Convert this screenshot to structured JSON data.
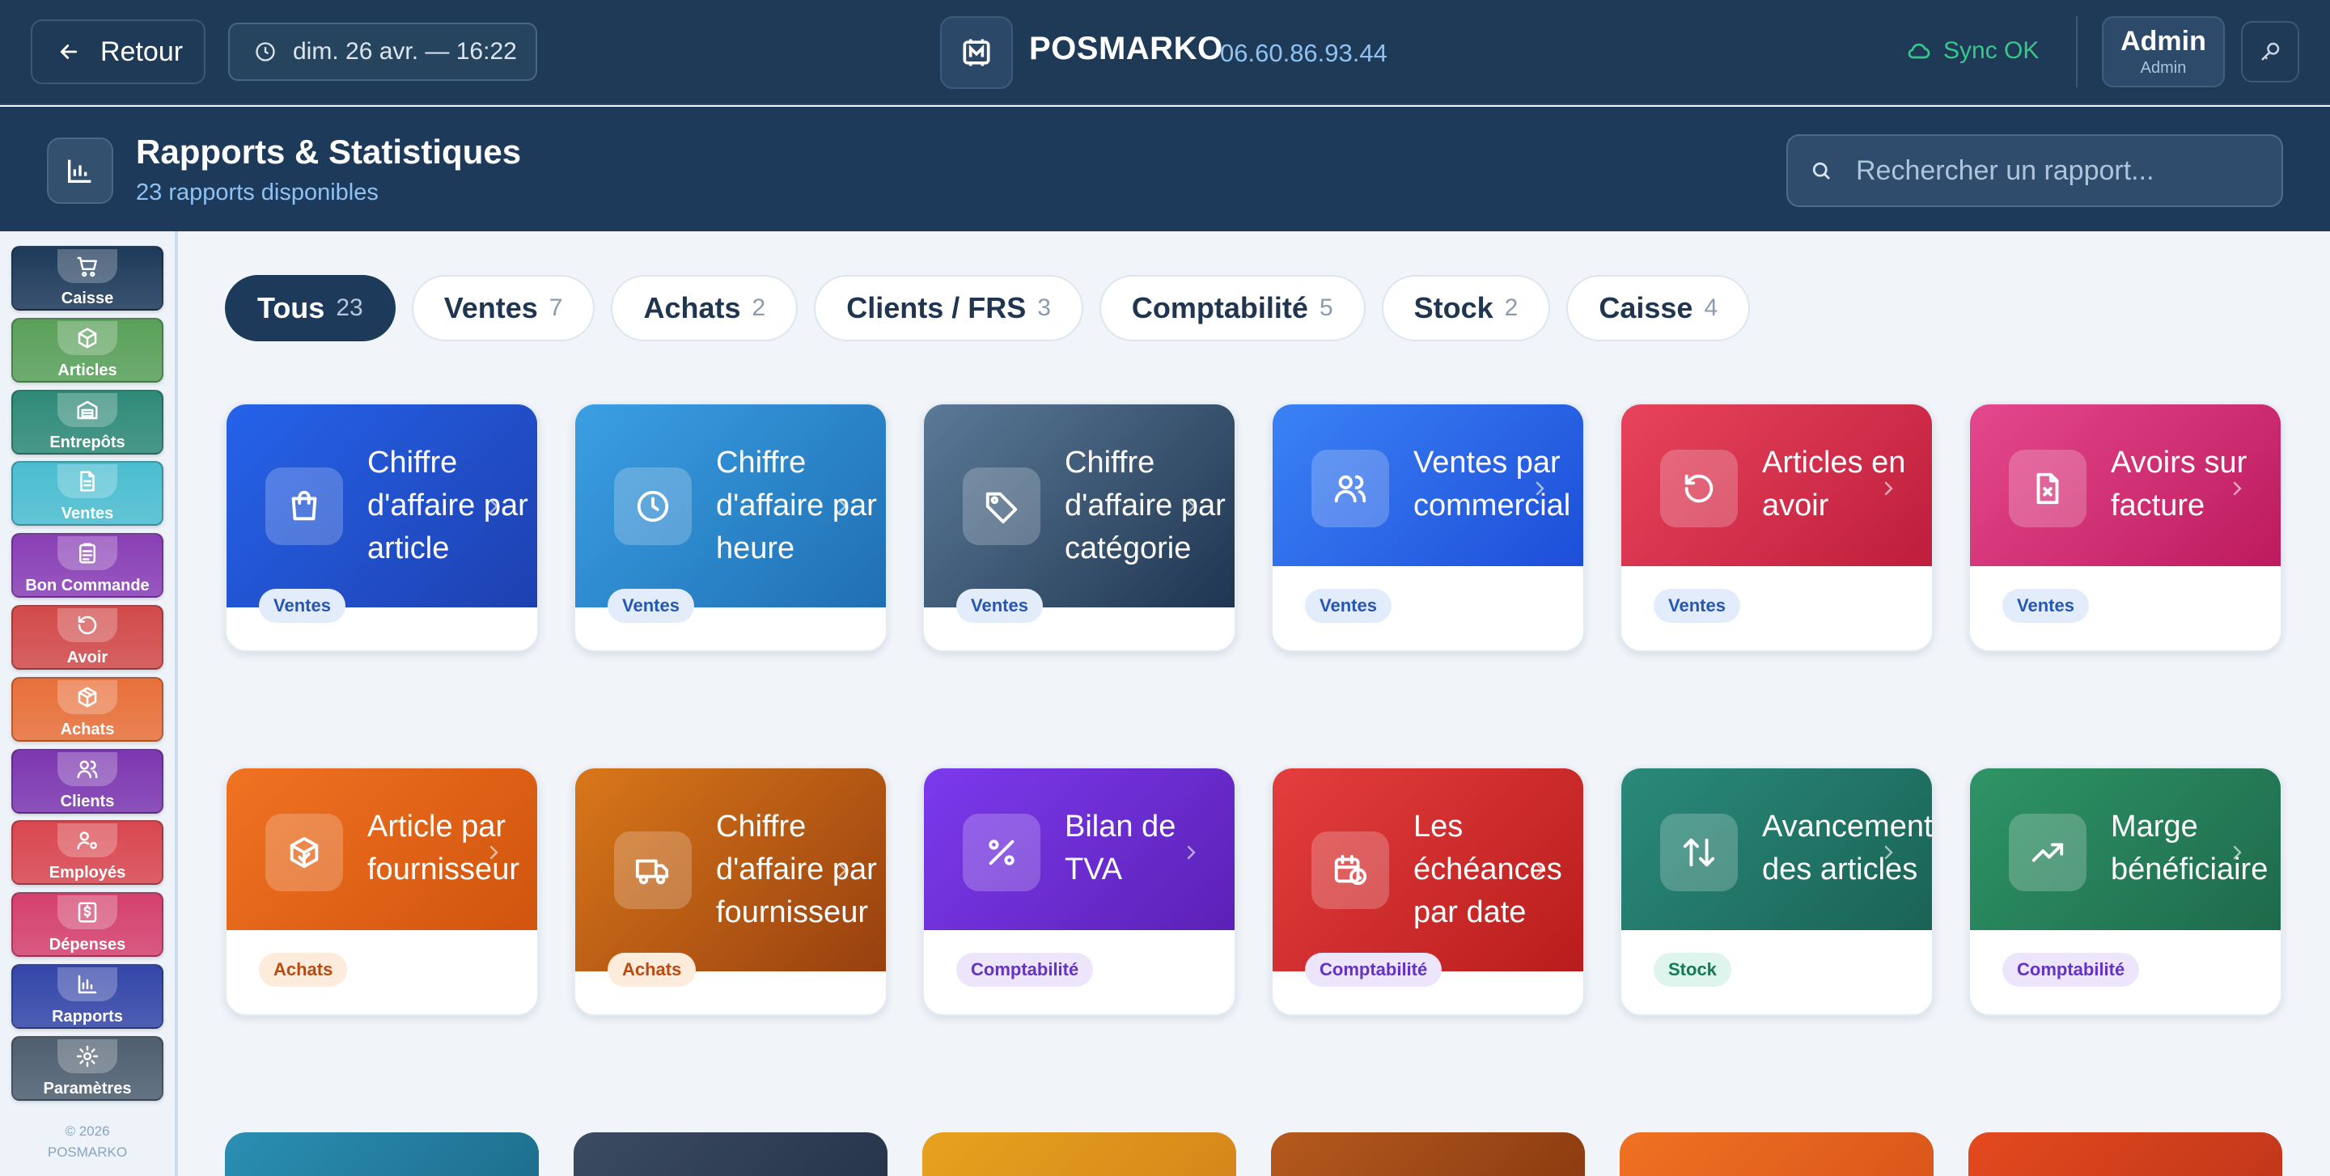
{
  "topbar": {
    "back_label": "Retour",
    "datetime": "dim. 26 avr. — 16:22",
    "brand": "POSMARKO",
    "phone": "06.60.86.93.44",
    "sync_status": "Sync OK",
    "user_name": "Admin",
    "user_role": "Admin"
  },
  "header": {
    "title": "Rapports & Statistiques",
    "subtitle": "23 rapports disponibles",
    "search_placeholder": "Rechercher un rapport..."
  },
  "sidebar": {
    "items": [
      {
        "label": "Caisse",
        "icon": "cart-icon",
        "color": "#1e3a5a"
      },
      {
        "label": "Articles",
        "icon": "box-icon",
        "color": "#5aa05a"
      },
      {
        "label": "Entrepôts",
        "icon": "warehouse-icon",
        "color": "#2f8a78"
      },
      {
        "label": "Ventes",
        "icon": "document-icon",
        "color": "#4bbdd0"
      },
      {
        "label": "Bon Commande",
        "icon": "clipboard-icon",
        "color": "#8a3fb5"
      },
      {
        "label": "Avoir",
        "icon": "undo-icon",
        "color": "#d24a4a"
      },
      {
        "label": "Achats",
        "icon": "package-icon",
        "color": "#e8703a"
      },
      {
        "label": "Clients",
        "icon": "users-icon",
        "color": "#7c37b0"
      },
      {
        "label": "Employés",
        "icon": "user-cog-icon",
        "color": "#d9474f"
      },
      {
        "label": "Dépenses",
        "icon": "receipt-icon",
        "color": "#d4416e"
      },
      {
        "label": "Rapports",
        "icon": "bar-chart-icon",
        "color": "#3446a8"
      },
      {
        "label": "Paramètres",
        "icon": "gear-icon",
        "color": "#4f5f70"
      }
    ],
    "active": "Rapports",
    "copyright_line1": "© 2026",
    "copyright_line2": "POSMARKO"
  },
  "tabs": [
    {
      "label": "Tous",
      "count": "23",
      "active": true
    },
    {
      "label": "Ventes",
      "count": "7"
    },
    {
      "label": "Achats",
      "count": "2"
    },
    {
      "label": "Clients / FRS",
      "count": "3"
    },
    {
      "label": "Comptabilité",
      "count": "5"
    },
    {
      "label": "Stock",
      "count": "2"
    },
    {
      "label": "Caisse",
      "count": "4"
    }
  ],
  "cards": [
    {
      "title": "Chiffre d'affaire par article",
      "category": "Ventes",
      "icon": "shopping-bag-icon",
      "colors": [
        "#2563eb",
        "#1e40af"
      ]
    },
    {
      "title": "Chiffre d'affaire par heure",
      "category": "Ventes",
      "icon": "clock-icon",
      "colors": [
        "#3b9fe4",
        "#1f6fb2"
      ]
    },
    {
      "title": "Chiffre d'affaire par catégorie",
      "category": "Ventes",
      "icon": "tag-icon",
      "colors": [
        "#5b7a98",
        "#1f3550"
      ]
    },
    {
      "title": "Ventes par commercial",
      "category": "Ventes",
      "icon": "users-icon",
      "colors": [
        "#3b82f6",
        "#1d4ed8"
      ]
    },
    {
      "title": "Articles en avoir",
      "category": "Ventes",
      "icon": "undo-icon",
      "colors": [
        "#e8435c",
        "#be1e3c"
      ]
    },
    {
      "title": "Avoirs sur facture",
      "category": "Ventes",
      "icon": "file-x-icon",
      "colors": [
        "#e4488c",
        "#be1a5e"
      ]
    },
    {
      "title": "Article par fournisseur",
      "category": "Achats",
      "icon": "package-check-icon",
      "colors": [
        "#f07222",
        "#d1540e"
      ]
    },
    {
      "title": "Chiffre d'affaire par fournisseur",
      "category": "Achats",
      "icon": "truck-icon",
      "colors": [
        "#d9771a",
        "#97400f"
      ]
    },
    {
      "title": "Bilan de TVA",
      "category": "Comptabilité",
      "icon": "percent-icon",
      "colors": [
        "#7c3aed",
        "#5b21b6"
      ]
    },
    {
      "title": "Les échéances par date",
      "category": "Comptabilité",
      "icon": "calendar-clock-icon",
      "colors": [
        "#e43e3e",
        "#b91c1c"
      ]
    },
    {
      "title": "Avancement des articles",
      "category": "Stock",
      "icon": "arrows-up-down-icon",
      "colors": [
        "#2a8a7a",
        "#1a6356"
      ]
    },
    {
      "title": "Marge bénéficiaire",
      "category": "Comptabilité",
      "icon": "trending-up-icon",
      "colors": [
        "#2e9466",
        "#1e6a4b"
      ]
    }
  ]
}
